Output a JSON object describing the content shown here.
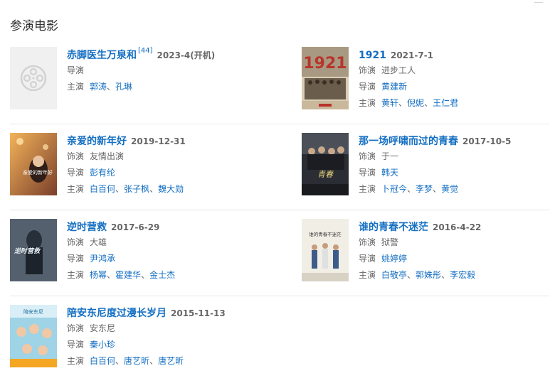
{
  "section_title": "参演电影",
  "labels": {
    "role": "饰演",
    "director": "导演",
    "cast": "主演"
  },
  "films": [
    {
      "title": "赤脚医生万泉和",
      "cite": "[44]",
      "date": "2023-4(开机)",
      "role": "",
      "director": [],
      "cast": [
        "郭涛",
        "孔琳"
      ]
    },
    {
      "title": "1921",
      "date": "2021-7-1",
      "role": "进步工人",
      "director": [
        "黄建新"
      ],
      "cast": [
        "黄轩",
        "倪妮",
        "王仁君"
      ],
      "poster_text": "1921"
    },
    {
      "title": "亲爱的新年好",
      "date": "2019-12-31",
      "role": "友情出演",
      "director": [
        "彭有纶"
      ],
      "cast": [
        "白百何",
        "张子枫",
        "魏大勋"
      ],
      "poster_text": "亲爱的新年好"
    },
    {
      "title": "那一场呼啸而过的青春",
      "date": "2017-10-5",
      "role": "于一",
      "director": [
        "韩天"
      ],
      "cast": [
        "卜冠今",
        "李梦",
        "黄觉"
      ],
      "poster_text": "青春"
    },
    {
      "title": "逆时营救",
      "date": "2017-6-29",
      "role": "大雄",
      "director": [
        "尹鸿承"
      ],
      "cast": [
        "杨幂",
        "霍建华",
        "金士杰"
      ],
      "poster_text": "逆时营救"
    },
    {
      "title": "谁的青春不迷茫",
      "date": "2016-4-22",
      "role": "狱警",
      "director": [
        "姚婷婷"
      ],
      "cast": [
        "白敬亭",
        "郭姝彤",
        "李宏毅"
      ],
      "poster_text": "谁的青春不迷茫"
    },
    {
      "title": "陪安东尼度过漫长岁月",
      "date": "2015-11-13",
      "role": "安东尼",
      "director": [
        "秦小珍"
      ],
      "cast": [
        "白百何",
        "唐艺昕",
        "唐艺昕"
      ],
      "poster_text": "陪安东尼"
    }
  ]
}
